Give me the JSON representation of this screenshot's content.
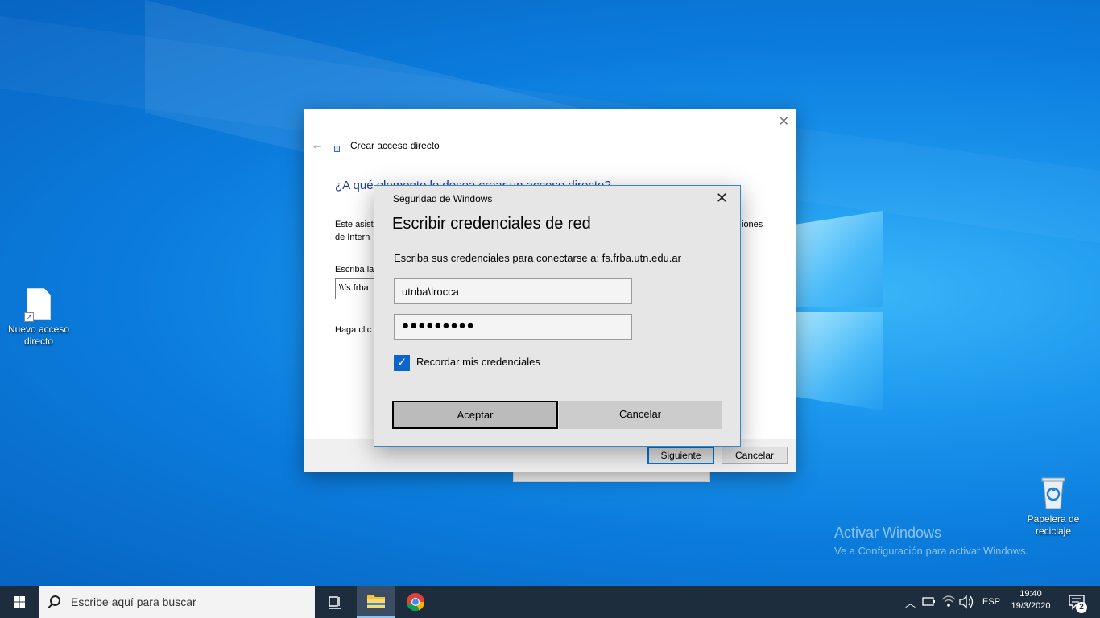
{
  "desktop": {
    "icons": [
      {
        "label": "Nuevo acceso directo"
      },
      {
        "label": "Papelera de reciclaje"
      }
    ],
    "activation": {
      "title": "Activar Windows",
      "subtitle": "Ve a Configuración para activar Windows."
    }
  },
  "wizard": {
    "title": "Crear acceso directo",
    "question": "¿A qué elemento le desea crear un acceso directo?",
    "desc_line1": "Este asist",
    "desc_line1_tail": "iones",
    "desc_line2": "de Intern",
    "location_label": "Escriba la",
    "location_value": "\\\\fs.frba",
    "hint": "Haga clic",
    "next_label": "Siguiente",
    "cancel_label": "Cancelar"
  },
  "security": {
    "app_name": "Seguridad de Windows",
    "title": "Escribir credenciales de red",
    "prompt": "Escriba sus credenciales para conectarse a: fs.frba.utn.edu.ar",
    "username": "utnba\\lrocca",
    "password_mask": "●●●●●●●●●",
    "remember_label": "Recordar mis credenciales",
    "remember_checked": true,
    "ok_label": "Aceptar",
    "cancel_label": "Cancelar"
  },
  "taskbar": {
    "search_placeholder": "Escribe aquí para buscar",
    "language": "ESP",
    "time": "19:40",
    "date": "19/3/2020",
    "notifications": "2"
  },
  "colors": {
    "desktop": "#0b7cdc",
    "taskbar": "#1d2d3e",
    "accent": "#0078d7",
    "dialog_bg": "#e6e6e6"
  }
}
